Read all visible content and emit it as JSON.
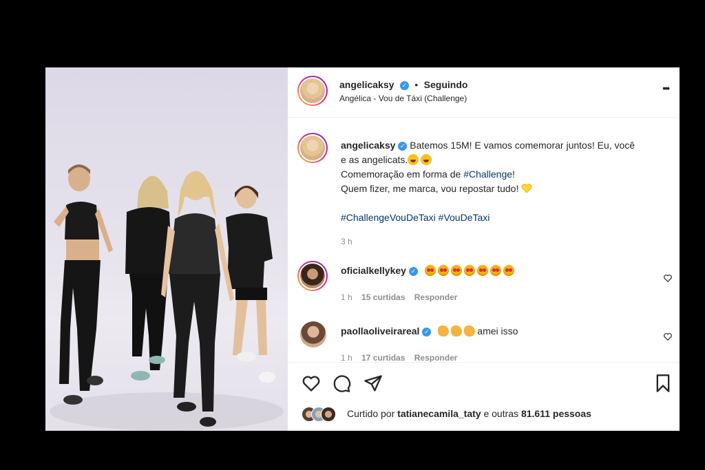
{
  "post_header": {
    "username": "angelicaksy",
    "separator": "•",
    "follow_status": "Seguindo",
    "audio": "Angélica - Vou de Táxi (Challenge)",
    "more_label": "•••"
  },
  "caption": {
    "username": "angelicaksy",
    "line1": "Batemos 15M! E vamos comemorar juntos! Eu, você",
    "line2": "e as angelicats.",
    "line3_text": "Comemoração em forma de ",
    "line3_tag": "#Challenge",
    "line3_end": "!",
    "line4": "Quem fizer, me marca, vou repostar tudo!",
    "tag1": "#ChallengeVouDeTaxi",
    "tag2": "#VouDeTaxi",
    "time": "3 h"
  },
  "comments": [
    {
      "username": "oficialkellykey",
      "text": "",
      "emoji_count": 7,
      "time": "1 h",
      "likes": "15 curtidas",
      "reply": "Responder"
    },
    {
      "username": "paollaoliveirareal",
      "text": "amei isso",
      "emoji_count": 3,
      "time": "1 h",
      "likes": "17 curtidas",
      "reply": "Responder"
    }
  ],
  "actions": {
    "liked_by_prefix": "Curtido por",
    "liked_by_user": "tatianecamila_taty",
    "liked_by_suffix": "e outras",
    "likes_count": "81.611",
    "likes_word": "pessoas"
  },
  "icons": [
    "like-icon",
    "comment-icon",
    "share-icon",
    "save-icon",
    "more-icon",
    "verified-badge-icon",
    "heart-small-icon"
  ],
  "colors": {
    "verified": "#3897f0",
    "link": "#00376b",
    "meta": "#8e8e8e"
  }
}
